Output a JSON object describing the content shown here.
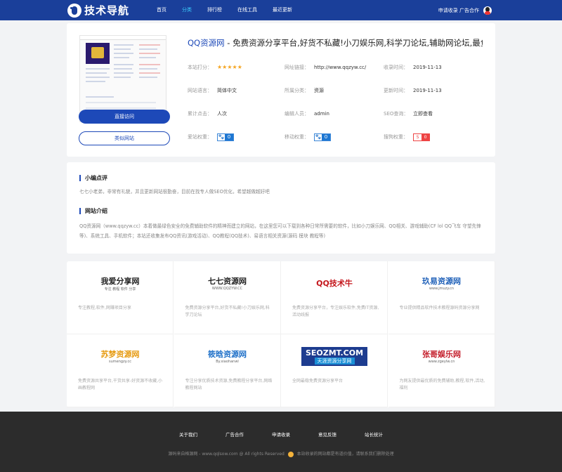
{
  "header": {
    "logo_text": "技术导航",
    "nav": [
      "首页",
      "分类",
      "排行榜",
      "在线工具",
      "最近更新"
    ],
    "active_index": 1,
    "right_text": "申请收录 广告合作"
  },
  "site": {
    "name": "QQ资源网",
    "title_rest": " - 免费资源分享平台,好货不私藏!小刀娱乐网,科学刀论坛,辅助网论坛,最负责…",
    "visit_label": "直接访问",
    "similar_label": "类似网站",
    "rows": [
      [
        {
          "label": "本站打分：",
          "value": "★★★★★",
          "kind": "stars"
        },
        {
          "label": "网址链接：",
          "value": "http://www.qqzyw.cc/"
        },
        {
          "label": "收录时间：",
          "value": "2019-11-13"
        }
      ],
      [
        {
          "label": "网站语言：",
          "value": "简体中文"
        },
        {
          "label": "所属分类：",
          "value": "资源"
        },
        {
          "label": "更新时间：",
          "value": "2019-11-13"
        }
      ],
      [
        {
          "label": "累计点击：",
          "value": "人次"
        },
        {
          "label": "编辑人员：",
          "value": "admin"
        },
        {
          "label": "SEO查询：",
          "value": "立即查看"
        }
      ],
      [
        {
          "label": "爱站权重：",
          "value": "0",
          "kind": "weight"
        },
        {
          "label": "移动权重：",
          "value": "0",
          "kind": "weight"
        },
        {
          "label": "搜狗权重：",
          "value": "",
          "kind": "sogou"
        }
      ]
    ]
  },
  "comment": {
    "title": "小编点评",
    "text": "七七小老弟，非常有礼貌，并且更新网站很勤奋，目前在找专人做SEO优化，希望越做越好吧",
    "intro_title": "网站介绍",
    "intro_text": "QQ资源网（www.qqzyw.cc）本着做最绿色安全的免费辅助软件的精神而建立的网站，在这里您可以下载到各种日常所需要的软件，比如小刀娱乐网、QQ相关、游戏辅助(CF lol QQ飞车 守望先锋等)、系统工具、手机软件；本站还收集发布QQ资讯(游戏活动)、QQ教程(QQ技术)、易语言相关资源(源码 模块 教程等)"
  },
  "related": [
    {
      "logo": "我爱分享网",
      "sub": "专注 教程 软件 分享",
      "desc": "专注教程,软件,网赚项目分享",
      "color": "#222"
    },
    {
      "logo": "七七资源网",
      "sub": "WWW.QQZYW.CC",
      "desc": "免费资源分享平台,好货不私藏!小刀娱乐网,科学刀论坛",
      "color": "#222"
    },
    {
      "logo": "QQ技术牛",
      "sub": "",
      "desc": "免费资源分享平台，专注娱乐软件,免费IT资源,活动线报",
      "color": "#c4161c"
    },
    {
      "logo": "玖易资源网",
      "sub": "www.jmuzy.cn",
      "desc": "专业提供精品软件技术教程源码资源分享网",
      "color": "#1d5fb8"
    },
    {
      "logo": "苏梦资源网",
      "sub": "sumengzy.cc",
      "desc": "免费资源共享平台,干货共享-好资源不收藏,小画教程网",
      "color": "#e69a0f"
    },
    {
      "logo": "筱晗资源网",
      "sub": "By.xiaohanwl",
      "desc": "专注分享优质技术资源,免费教程分享平台,网络教程网站",
      "color": "#1d6fc8"
    },
    {
      "logo": "SEOZMT.COM",
      "sub": "天涯资源分享网",
      "desc": "全网最稳免费资源分享平台",
      "color": "#fff"
    },
    {
      "logo": "张哥娱乐网",
      "sub": "www.zgeylw.cn",
      "desc": "为网友提供最优质的免费辅助,教程,软件,活动,福利",
      "color": "#c41d2a"
    }
  ],
  "footer": {
    "links": [
      "关于我们",
      "广告合作",
      "申请收录",
      "意见反馈",
      "站长统计"
    ],
    "copyright_left": "源码来自格源网 - www.qqlsow.com @ All rights Reserved",
    "copyright_right": "本站收录的网站都是有道价值，请联系我们删除处理"
  }
}
